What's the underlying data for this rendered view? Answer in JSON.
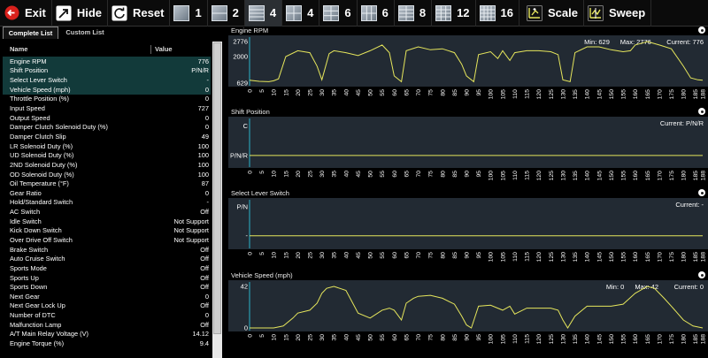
{
  "toolbar": {
    "exit_label": "Exit",
    "hide_label": "Hide",
    "reset_label": "Reset",
    "layouts": [
      {
        "label": "1",
        "icon": "grid-1-icon",
        "cols": 1,
        "rows": 1
      },
      {
        "label": "2",
        "icon": "grid-2-icon",
        "cols": 1,
        "rows": 2
      },
      {
        "label": "4",
        "icon": "grid-4-stack-icon",
        "cols": 1,
        "rows": 4
      },
      {
        "label": "4",
        "icon": "grid-4-icon",
        "cols": 2,
        "rows": 2
      },
      {
        "label": "6",
        "icon": "grid-6-icon",
        "cols": 2,
        "rows": 3
      },
      {
        "label": "6",
        "icon": "grid-6-wide-icon",
        "cols": 3,
        "rows": 2
      },
      {
        "label": "8",
        "icon": "grid-8-icon",
        "cols": 2,
        "rows": 4
      },
      {
        "label": "12",
        "icon": "grid-12-icon",
        "cols": 3,
        "rows": 4
      },
      {
        "label": "16",
        "icon": "grid-16-icon",
        "cols": 4,
        "rows": 4
      }
    ],
    "selected_layout_index": 2,
    "scale_label": "Scale",
    "sweep_label": "Sweep",
    "exit_icon_color": "#d9211c"
  },
  "left": {
    "tabs": [
      "Complete List",
      "Custom List"
    ],
    "header": {
      "name": "Name",
      "value": "Value"
    },
    "highlight_color": "#123a3a",
    "rows": [
      {
        "name": "Engine RPM",
        "value": "776",
        "hl": true
      },
      {
        "name": "Shift Position",
        "value": "P/N/R",
        "hl": true
      },
      {
        "name": "Select Lever Switch",
        "value": "-",
        "hl": true
      },
      {
        "name": "Vehicle Speed (mph)",
        "value": "0",
        "hl": true
      },
      {
        "name": "Throttle Position (%)",
        "value": "0",
        "hl": false
      },
      {
        "name": "Input Speed",
        "value": "727",
        "hl": false
      },
      {
        "name": "Output Speed",
        "value": "0",
        "hl": false
      },
      {
        "name": "Damper Clutch Solenoid Duty (%)",
        "value": "0",
        "hl": false
      },
      {
        "name": "Damper Clutch Slip",
        "value": "49",
        "hl": false
      },
      {
        "name": "LR Solenoid Duty (%)",
        "value": "100",
        "hl": false
      },
      {
        "name": "UD Solenoid Duty (%)",
        "value": "100",
        "hl": false
      },
      {
        "name": "2ND Solenoid Duty (%)",
        "value": "100",
        "hl": false
      },
      {
        "name": "OD Solenoid Duty (%)",
        "value": "100",
        "hl": false
      },
      {
        "name": "Oil Temperature (°F)",
        "value": "87",
        "hl": false
      },
      {
        "name": "Gear Ratio",
        "value": "0",
        "hl": false
      },
      {
        "name": "Hold/Standard Switch",
        "value": "-",
        "hl": false
      },
      {
        "name": "AC Switch",
        "value": "Off",
        "hl": false
      },
      {
        "name": "Idle Switch",
        "value": "Not Support",
        "hl": false
      },
      {
        "name": "Kick Down Switch",
        "value": "Not Support",
        "hl": false
      },
      {
        "name": "Over Drive Off Switch",
        "value": "Not Support",
        "hl": false
      },
      {
        "name": "Brake Switch",
        "value": "Off",
        "hl": false
      },
      {
        "name": "Auto Cruise Switch",
        "value": "Off",
        "hl": false
      },
      {
        "name": "Sports Mode",
        "value": "Off",
        "hl": false
      },
      {
        "name": "Sports Up",
        "value": "Off",
        "hl": false
      },
      {
        "name": "Sports Down",
        "value": "Off",
        "hl": false
      },
      {
        "name": "Next Gear",
        "value": "0",
        "hl": false
      },
      {
        "name": "Next Gear Lock Up",
        "value": "Off",
        "hl": false
      },
      {
        "name": "Number of DTC",
        "value": "0",
        "hl": false
      },
      {
        "name": "Malfunction Lamp",
        "value": "Off",
        "hl": false
      },
      {
        "name": "A/T Main Relay Voltage (V)",
        "value": "14.12",
        "hl": false
      },
      {
        "name": "Engine Torque (%)",
        "value": "9.4",
        "hl": false
      }
    ]
  },
  "chart_data": [
    {
      "type": "line",
      "title": "Engine RPM",
      "stats": {
        "min": "Min: 629",
        "max": "Max: 2776",
        "current": "Current: 776"
      },
      "ytick_labels": [
        "2776",
        "2000",
        "629"
      ],
      "ytick_values": [
        2776,
        2000,
        629
      ],
      "ylim": [
        629,
        2776
      ],
      "xlim": [
        0,
        188
      ],
      "line_color": "#e6e65c",
      "x": [
        0,
        4,
        8,
        10,
        12,
        15,
        20,
        25,
        28,
        30,
        33,
        35,
        40,
        45,
        50,
        55,
        58,
        60,
        63,
        65,
        70,
        75,
        80,
        85,
        88,
        90,
        93,
        95,
        100,
        103,
        105,
        108,
        110,
        115,
        120,
        125,
        128,
        130,
        133,
        135,
        140,
        145,
        150,
        155,
        158,
        160,
        163,
        165,
        170,
        175,
        180,
        183,
        186,
        188
      ],
      "y": [
        780,
        720,
        700,
        750,
        850,
        2000,
        2300,
        2200,
        1500,
        800,
        2150,
        2300,
        2200,
        2050,
        2300,
        2600,
        2200,
        1000,
        700,
        2300,
        2500,
        2350,
        2400,
        2200,
        1600,
        1000,
        700,
        2100,
        2250,
        1900,
        2300,
        1800,
        2200,
        2300,
        2300,
        2250,
        2100,
        800,
        700,
        2200,
        2500,
        2500,
        2350,
        2250,
        2300,
        2600,
        2700,
        2776,
        2600,
        2400,
        1500,
        900,
        800,
        776
      ]
    },
    {
      "type": "line",
      "title": "Shift Position",
      "stats": {
        "current": "Current: P/N/R"
      },
      "ytick_labels": [
        "C",
        "P/N/R"
      ],
      "ytick_values": [
        1,
        0
      ],
      "ylim": [
        -0.3,
        1.1
      ],
      "xlim": [
        0,
        188
      ],
      "line_color": "#e6e65c",
      "x": [
        0,
        188
      ],
      "y": [
        0,
        0
      ]
    },
    {
      "type": "line",
      "title": "Select Lever Switch",
      "stats": {
        "current": "Current: -"
      },
      "ytick_labels": [
        "P/N",
        "-"
      ],
      "ytick_values": [
        1,
        0
      ],
      "ylim": [
        -0.35,
        1.1
      ],
      "xlim": [
        0,
        188
      ],
      "line_color": "#e6e65c",
      "x": [
        0,
        188
      ],
      "y": [
        0,
        0
      ]
    },
    {
      "type": "line",
      "title": "Vehicle Speed (mph)",
      "stats": {
        "min": "Min: 0",
        "max": "Max: 42",
        "current": "Current: 0"
      },
      "ytick_labels": [
        "42",
        "0"
      ],
      "ytick_values": [
        42,
        0
      ],
      "ylim": [
        0,
        42
      ],
      "xlim": [
        0,
        188
      ],
      "line_color": "#e6e65c",
      "x": [
        0,
        10,
        14,
        18,
        20,
        25,
        28,
        30,
        32,
        35,
        40,
        45,
        50,
        55,
        58,
        60,
        63,
        65,
        68,
        70,
        75,
        80,
        85,
        88,
        90,
        92,
        95,
        100,
        105,
        108,
        110,
        115,
        120,
        125,
        128,
        130,
        132,
        135,
        140,
        145,
        150,
        155,
        160,
        165,
        168,
        172,
        175,
        180,
        184,
        188
      ],
      "y": [
        0,
        0,
        2,
        10,
        15,
        18,
        25,
        35,
        40,
        42,
        38,
        15,
        10,
        18,
        20,
        18,
        8,
        25,
        30,
        32,
        33,
        30,
        24,
        12,
        3,
        0,
        22,
        23,
        18,
        22,
        14,
        20,
        20,
        20,
        18,
        8,
        0,
        12,
        22,
        22,
        22,
        24,
        35,
        42,
        40,
        30,
        22,
        8,
        2,
        0
      ]
    }
  ],
  "xaxis_ticks": [
    0,
    5,
    10,
    15,
    20,
    25,
    30,
    35,
    40,
    45,
    50,
    55,
    60,
    65,
    70,
    75,
    80,
    85,
    90,
    95,
    100,
    105,
    110,
    115,
    120,
    125,
    130,
    135,
    140,
    145,
    150,
    155,
    160,
    165,
    170,
    175,
    180,
    185,
    188
  ]
}
